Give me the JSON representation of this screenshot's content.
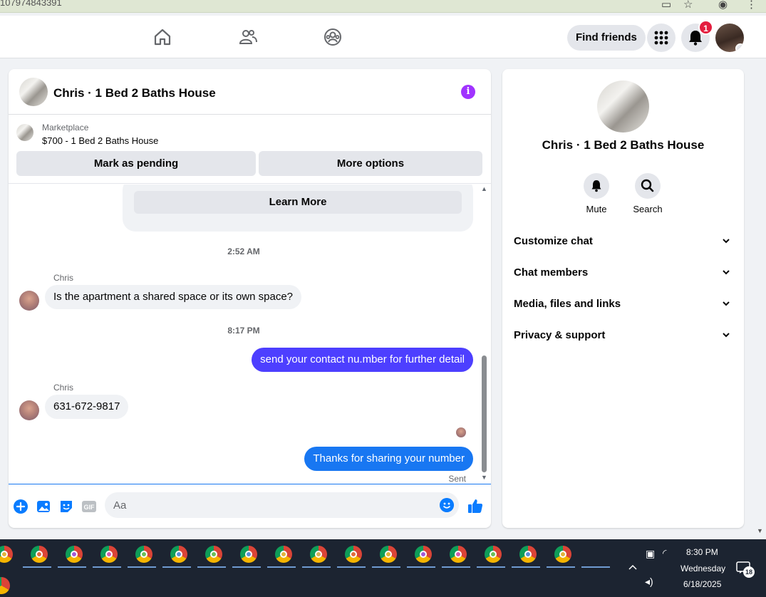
{
  "browser": {
    "url_fragment": "107974843391"
  },
  "topnav": {
    "find_friends_label": "Find friends",
    "notification_count": "1"
  },
  "chat": {
    "title": "Chris · 1 Bed 2 Baths House",
    "marketplace_label": "Marketplace",
    "listing": "$700 - 1 Bed 2 Baths House",
    "mark_pending_label": "Mark as pending",
    "more_options_label": "More options",
    "learn_more_label": "Learn More",
    "messages": [
      {
        "type": "timestamp",
        "text": "2:52 AM"
      },
      {
        "type": "incoming",
        "sender": "Chris",
        "text": "Is the apartment a shared space or its own space?"
      },
      {
        "type": "timestamp",
        "text": "8:17 PM"
      },
      {
        "type": "outgoing",
        "text": "send your contact nu.mber for further detail",
        "color": "#4d3fff"
      },
      {
        "type": "incoming",
        "sender": "Chris",
        "text": "631-672-9817"
      },
      {
        "type": "outgoing",
        "text": "Thanks for sharing your number",
        "color": "#1877f2"
      }
    ],
    "sent_status": "Sent",
    "composer_placeholder": "Aa"
  },
  "details": {
    "title": "Chris · 1 Bed 2 Baths House",
    "actions": [
      {
        "label": "Mute",
        "icon": "bell-icon"
      },
      {
        "label": "Search",
        "icon": "search-icon"
      }
    ],
    "sections": [
      {
        "label": "Customize chat"
      },
      {
        "label": "Chat members"
      },
      {
        "label": "Media, files and links"
      },
      {
        "label": "Privacy & support"
      }
    ]
  },
  "taskbar": {
    "time": "8:30 PM",
    "day": "Wednesday",
    "date": "6/18/2025",
    "notification_count": "18"
  },
  "colors": {
    "accent": "#1877f2",
    "violet_bubble": "#4d3fff",
    "info": "#a033ff",
    "badge": "#e41e3f",
    "taskbar": "#1c2431"
  }
}
